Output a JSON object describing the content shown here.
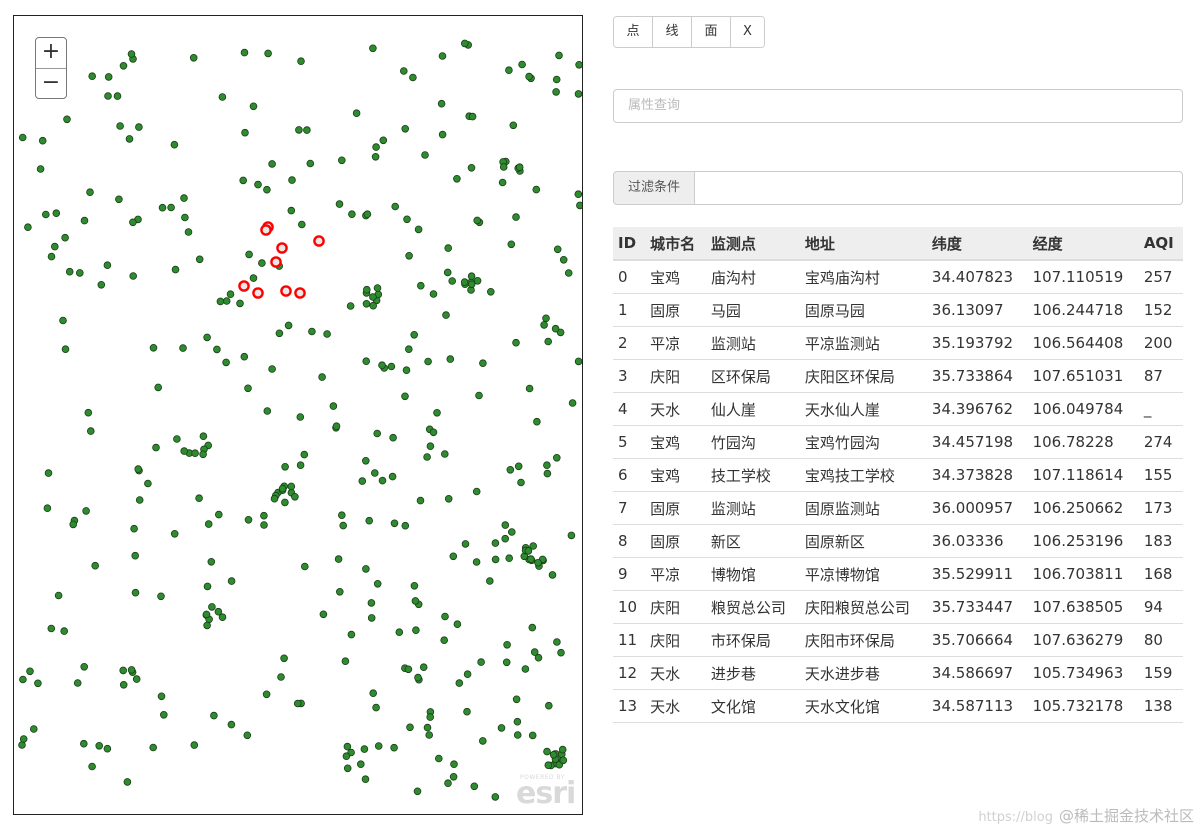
{
  "map": {
    "zoom_in_label": "+",
    "zoom_out_label": "−",
    "logo_text": "esri",
    "logo_small_text": "POWERED BY",
    "point_color": "#2e8b2e",
    "selected_color": "#ff0000"
  },
  "toolbar": {
    "point_label": "点",
    "line_label": "线",
    "polygon_label": "面",
    "clear_label": "X"
  },
  "query": {
    "placeholder": "属性查询"
  },
  "filter": {
    "label": "过滤条件",
    "value": ""
  },
  "table": {
    "headers": [
      "ID",
      "城市名",
      "监测点",
      "地址",
      "纬度",
      "经度",
      "AQI"
    ],
    "rows": [
      [
        "0",
        "宝鸡",
        "庙沟村",
        "宝鸡庙沟村",
        "34.407823",
        "107.110519",
        "257"
      ],
      [
        "1",
        "固原",
        "马园",
        "固原马园",
        "36.13097",
        "106.244718",
        "152"
      ],
      [
        "2",
        "平凉",
        "监测站",
        "平凉监测站",
        "35.193792",
        "106.564408",
        "200"
      ],
      [
        "3",
        "庆阳",
        "区环保局",
        "庆阳区环保局",
        "35.733864",
        "107.651031",
        "87"
      ],
      [
        "4",
        "天水",
        "仙人崖",
        "天水仙人崖",
        "34.396762",
        "106.049784",
        "_"
      ],
      [
        "5",
        "宝鸡",
        "竹园沟",
        "宝鸡竹园沟",
        "34.457198",
        "106.78228",
        "274"
      ],
      [
        "6",
        "宝鸡",
        "技工学校",
        "宝鸡技工学校",
        "34.373828",
        "107.118614",
        "155"
      ],
      [
        "7",
        "固原",
        "监测站",
        "固原监测站",
        "36.000957",
        "106.250662",
        "173"
      ],
      [
        "8",
        "固原",
        "新区",
        "固原新区",
        "36.03336",
        "106.253196",
        "183"
      ],
      [
        "9",
        "平凉",
        "博物馆",
        "平凉博物馆",
        "35.529911",
        "106.703811",
        "168"
      ],
      [
        "10",
        "庆阳",
        "粮贸总公司",
        "庆阳粮贸总公司",
        "35.733447",
        "107.638505",
        "94"
      ],
      [
        "11",
        "庆阳",
        "市环保局",
        "庆阳市环保局",
        "35.706664",
        "107.636279",
        "80"
      ],
      [
        "12",
        "天水",
        "进步巷",
        "天水进步巷",
        "34.586697",
        "105.734963",
        "159"
      ],
      [
        "13",
        "天水",
        "文化馆",
        "天水文化馆",
        "34.587113",
        "105.732178",
        "138"
      ]
    ]
  },
  "watermark": {
    "url": "https://blog",
    "text": "@稀土掘金技术社区"
  }
}
